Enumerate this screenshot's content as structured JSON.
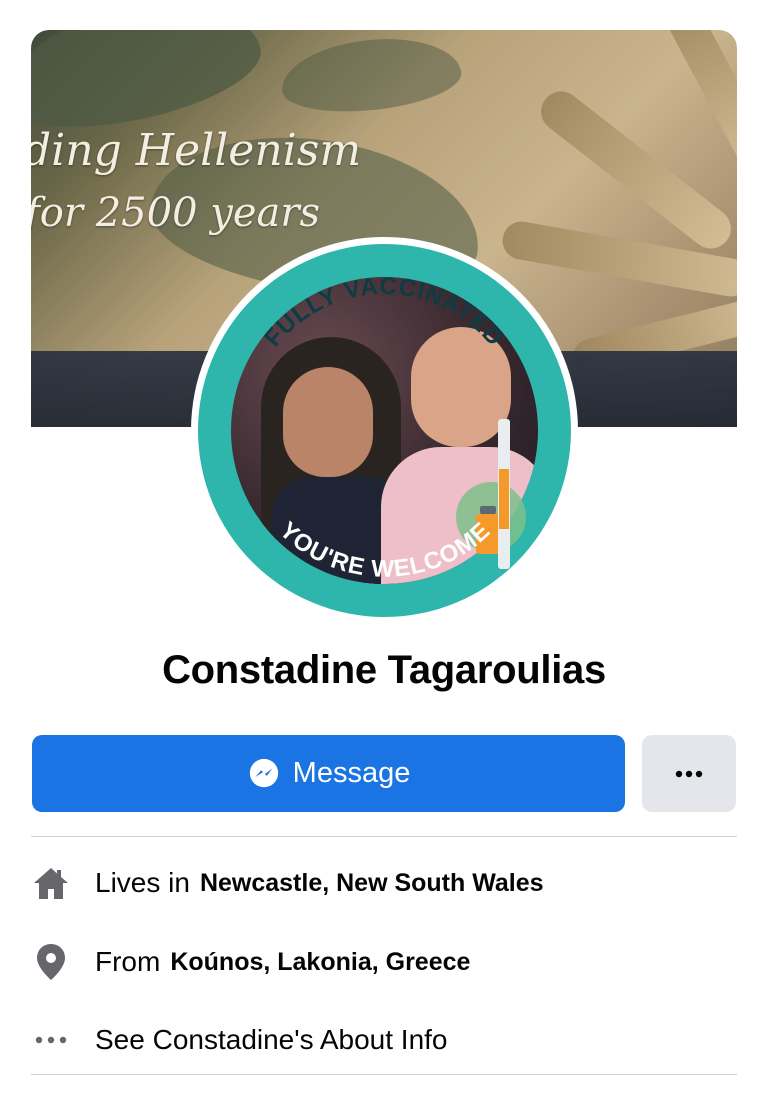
{
  "cover": {
    "line1": "ding Hellenism",
    "line2": "for 2500 years"
  },
  "avatar_frame": {
    "top_text": "FULLY VACCINATED",
    "bottom_text": "YOU'RE WELCOME",
    "ring_color": "#2fb6ac"
  },
  "profile": {
    "name": "Constadine Tagaroulias"
  },
  "actions": {
    "message_label": "Message",
    "message_icon": "messenger-icon",
    "more_icon": "more-dots-icon",
    "accent": "#1b74e4"
  },
  "intro": {
    "lives": {
      "prefix": "Lives in",
      "place": "Newcastle, New South Wales",
      "icon": "home-icon"
    },
    "from": {
      "prefix": "From",
      "place": "Koúnos, Lakonia, Greece",
      "icon": "location-pin-icon"
    },
    "about": {
      "label": "See Constadine's About Info",
      "icon": "more-dots-icon"
    }
  }
}
